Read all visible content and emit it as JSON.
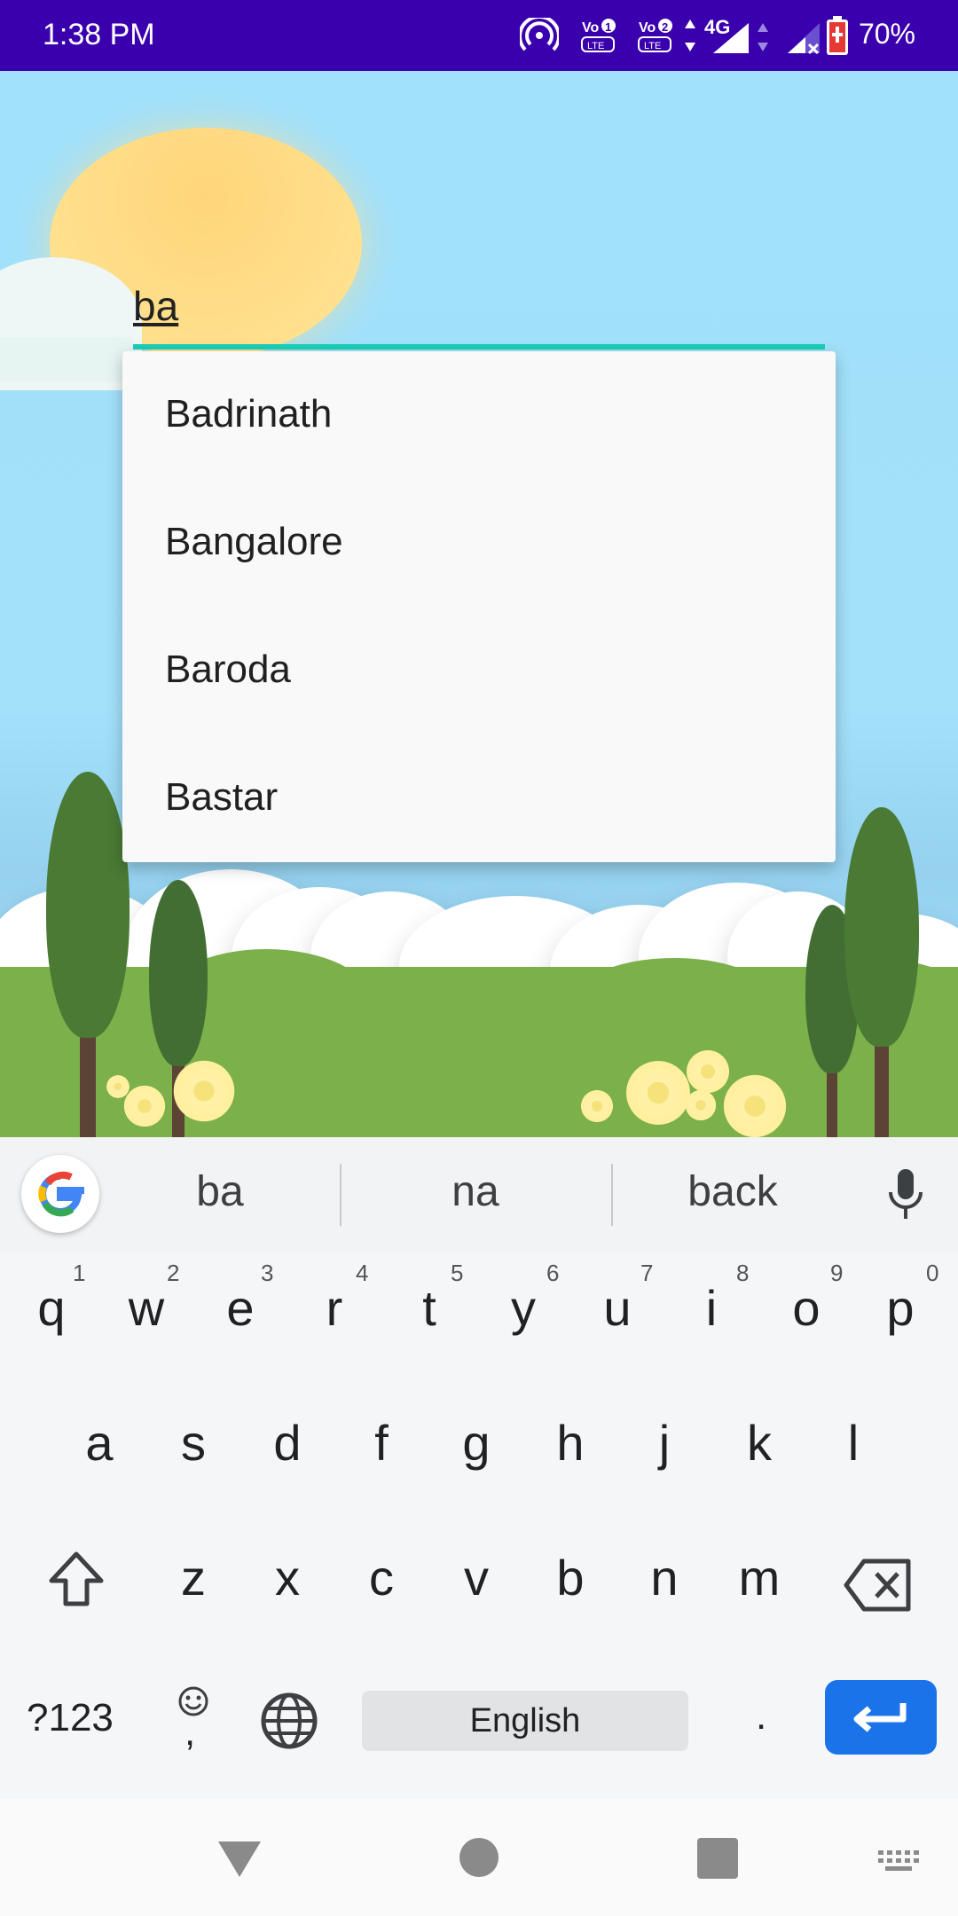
{
  "status_bar": {
    "time": "1:38 PM",
    "battery": "70%",
    "network_label": "4G",
    "volte1": "VoLTE 1",
    "volte2": "VoLTE 2"
  },
  "search": {
    "value": "ba",
    "underline_color": "#1bd0b8"
  },
  "suggestions": [
    "Badrinath",
    "Bangalore",
    "Baroda",
    "Bastar"
  ],
  "keyboard": {
    "strip": [
      "ba",
      "na",
      "back"
    ],
    "row1": [
      "q",
      "w",
      "e",
      "r",
      "t",
      "y",
      "u",
      "i",
      "o",
      "p"
    ],
    "row1_hints": [
      "1",
      "2",
      "3",
      "4",
      "5",
      "6",
      "7",
      "8",
      "9",
      "0"
    ],
    "row2": [
      "a",
      "s",
      "d",
      "f",
      "g",
      "h",
      "j",
      "k",
      "l"
    ],
    "row3": [
      "z",
      "x",
      "c",
      "v",
      "b",
      "n",
      "m"
    ],
    "symbols_label": "?123",
    "comma": ",",
    "period": ".",
    "space_label": "English",
    "enter_color": "#1a73e8"
  },
  "colors": {
    "status_bar": "#3a00ae",
    "sky": "#a3e0fa"
  }
}
